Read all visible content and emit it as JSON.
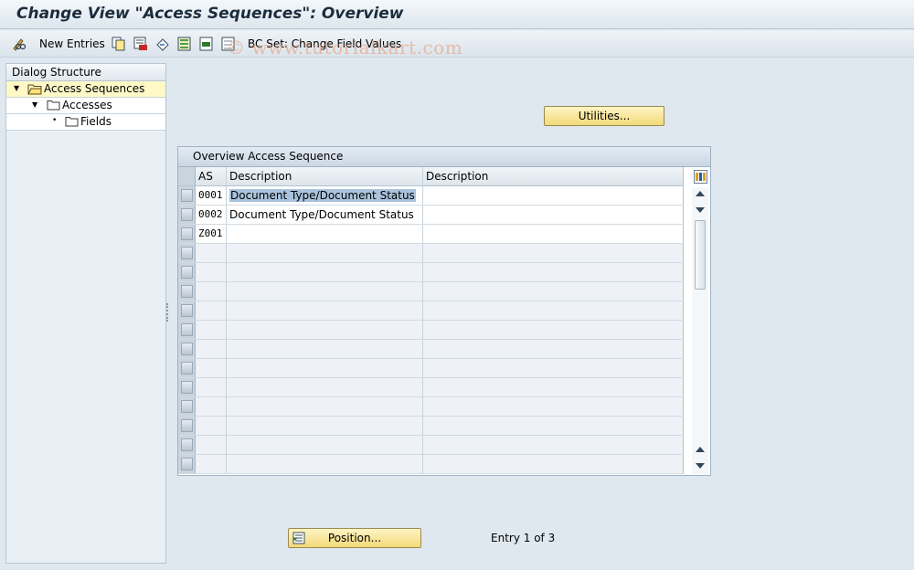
{
  "window": {
    "title": "Change View \"Access Sequences\": Overview"
  },
  "toolbar": {
    "new_entries": "New Entries",
    "bc_set": "BC Set: Change Field Values"
  },
  "watermark": "© www.tutorialkart.com",
  "dialog_structure": {
    "header": "Dialog Structure",
    "items": [
      {
        "label": "Access Sequences"
      },
      {
        "label": "Accesses"
      },
      {
        "label": "Fields"
      }
    ]
  },
  "utilities_button": "Utilities...",
  "table": {
    "title": "Overview Access Sequence",
    "columns": [
      "AS",
      "Description",
      "Description"
    ],
    "rows": [
      {
        "as": "0001",
        "description": "Document Type/Document Status",
        "description2": ""
      },
      {
        "as": "0002",
        "description": "Document Type/Document Status",
        "description2": ""
      },
      {
        "as": "Z001",
        "description": "",
        "description2": ""
      }
    ]
  },
  "footer": {
    "position_button": "Position...",
    "entry_text": "Entry 1 of 3"
  },
  "colors": {
    "accent_button": "#f2d978",
    "selection_highlight": "#a9c3dc",
    "tree_selection": "#fff9c8"
  }
}
